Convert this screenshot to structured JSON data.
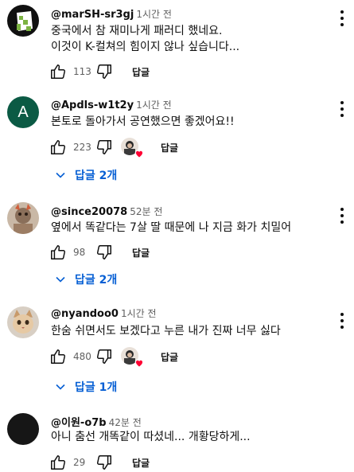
{
  "comments": [
    {
      "author": "@marSH-sr3gj",
      "time": "1시간 전",
      "lines": [
        "중국에서 참 재미나게 패러디 했네요.",
        "이것이 K-컬쳐의 힘이지 않나 싶습니다..."
      ],
      "likes": "113",
      "reply_label": "답글"
    },
    {
      "author": "@Apdls-w1t2y",
      "avatar_letter": "A",
      "time": "1시간 전",
      "lines": [
        "본토로 돌아가서 공연했으면 좋겠어요!!"
      ],
      "likes": "223",
      "reply_label": "답글",
      "replies_label": "답글 2개"
    },
    {
      "author": "@since20078",
      "time": "52분 전",
      "lines": [
        "옆에서 똑같다는 7살 딸 때문에 나 지금 화가 치밀어"
      ],
      "likes": "98",
      "reply_label": "답글",
      "replies_label": "답글 2개"
    },
    {
      "author": "@nyandoo0",
      "time": "1시간 전",
      "lines": [
        "한숨 쉬면서도 보겠다고 누른 내가 진짜 너무 싫다"
      ],
      "likes": "480",
      "reply_label": "답글",
      "replies_label": "답글 1개"
    },
    {
      "author": "@이원-o7b",
      "time": "42분 전",
      "lines": [
        "아니 춤선 개똑같이 따셨네... 개황당하게..."
      ],
      "likes": "29",
      "reply_label": "답글"
    }
  ],
  "colors": {
    "link_blue": "#065fd4",
    "meta_gray": "#606060",
    "heart_red": "#ff0033",
    "avatar_green": "#0b5a44"
  }
}
